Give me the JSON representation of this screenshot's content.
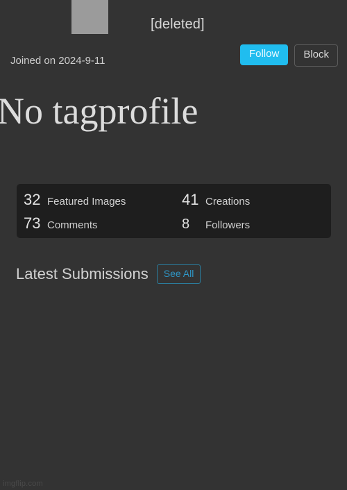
{
  "theme": {
    "page_bg": "#333333",
    "panel_bg": "#1e1e1e",
    "accent": "#20bdef",
    "link": "#2f97c7",
    "text": "#d4d4d4"
  },
  "header": {
    "avatar_label": "avatar-placeholder",
    "username": "[deleted]",
    "joined": "Joined on 2024-9-11",
    "follow_label": "Follow",
    "block_label": "Block"
  },
  "tagline": {
    "title": "No tagprofile"
  },
  "stats": [
    {
      "value": "32",
      "label": "Featured Images"
    },
    {
      "value": "41",
      "label": "Creations"
    },
    {
      "value": "73",
      "label": "Comments"
    },
    {
      "value": "8",
      "label": "Followers"
    }
  ],
  "submissions": {
    "title": "Latest Submissions",
    "see_all_label": "See All",
    "items": []
  },
  "footer": {
    "watermark": "imgflip.com"
  }
}
